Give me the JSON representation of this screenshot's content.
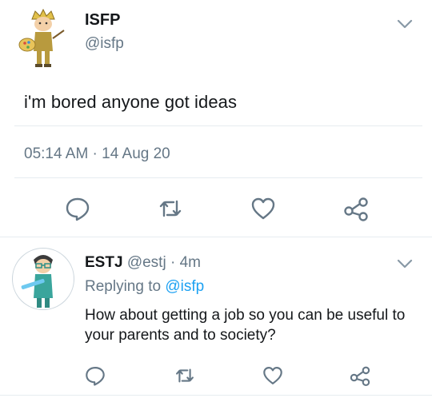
{
  "main_tweet": {
    "author_name": "ISFP",
    "author_handle": "@isfp",
    "text": "i'm bored anyone got ideas",
    "timestamp": "05:14 AM · 14 Aug 20",
    "icons": [
      "reply-icon",
      "retweet-icon",
      "like-icon",
      "share-icon",
      "chevron-down-icon"
    ]
  },
  "reply": {
    "author_name": "ESTJ",
    "author_handle": "@estj",
    "separator": " · ",
    "age": "4m",
    "replying_prefix": "Replying to ",
    "replying_to": "@isfp",
    "text": "How about getting a job so you can be useful to your parents and to society?",
    "icons": [
      "reply-icon",
      "retweet-icon",
      "like-icon",
      "share-icon",
      "chevron-down-icon"
    ]
  },
  "colors": {
    "text": "#14171a",
    "muted": "#657786",
    "link": "#1da1f2",
    "divider": "#e6ecf0"
  }
}
